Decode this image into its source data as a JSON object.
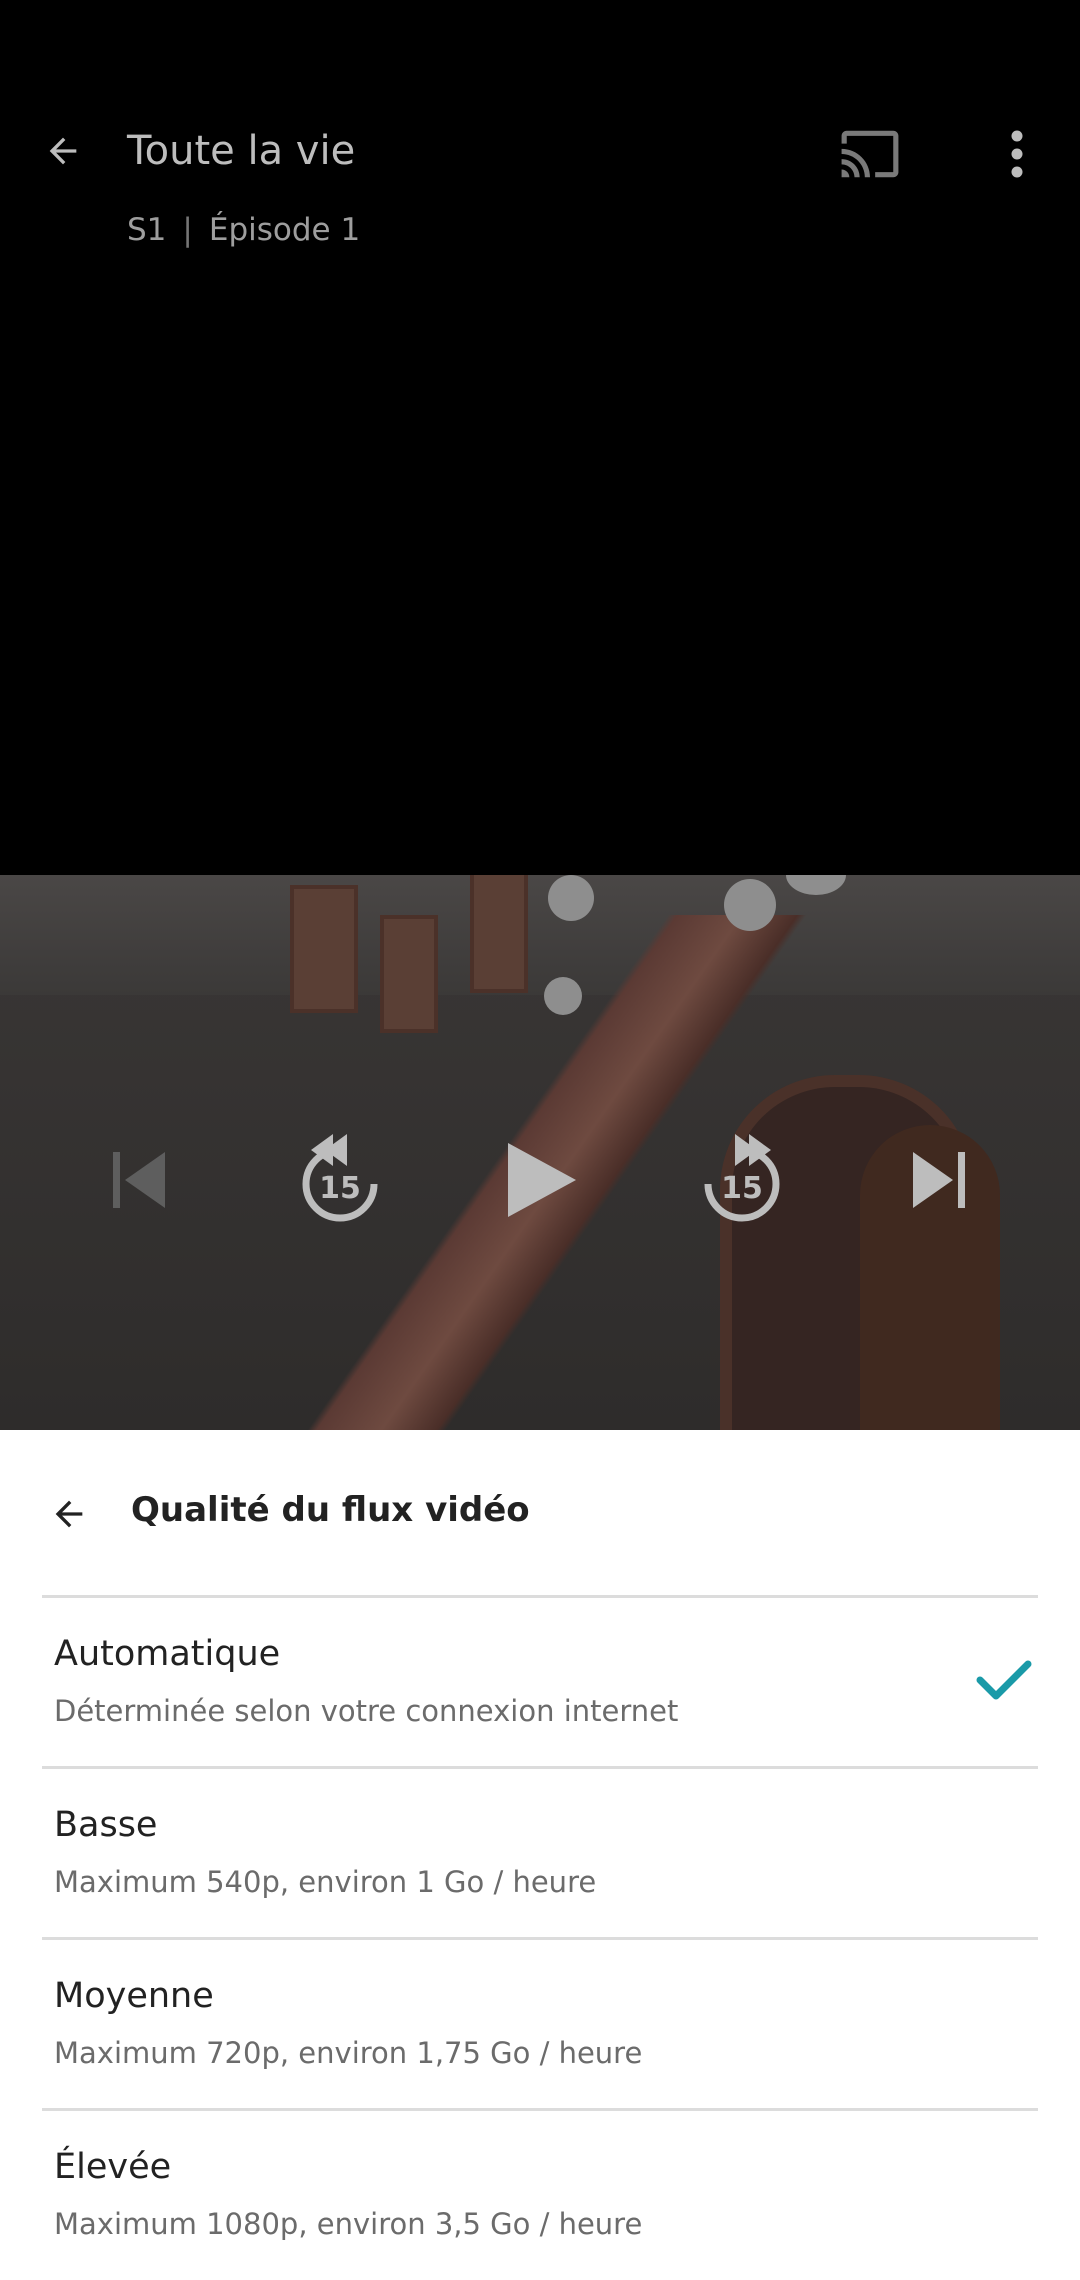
{
  "header": {
    "title": "Toute la vie",
    "season": "S1",
    "separator": "|",
    "episode": "Épisode 1",
    "icons": [
      "back-arrow-icon",
      "cast-icon",
      "more-vertical-icon"
    ]
  },
  "player": {
    "controls": [
      "skip-previous-icon",
      "rewind-15-icon",
      "play-icon",
      "forward-15-icon",
      "skip-next-icon"
    ],
    "rewind_seconds": "15",
    "forward_seconds": "15"
  },
  "quality_sheet": {
    "title": "Qualité du flux vidéo",
    "options": [
      {
        "label": "Automatique",
        "description": "Déterminée selon votre connexion internet",
        "selected": true
      },
      {
        "label": "Basse",
        "description": "Maximum 540p, environ 1 Go / heure",
        "selected": false
      },
      {
        "label": "Moyenne",
        "description": "Maximum 720p, environ 1,75 Go / heure",
        "selected": false
      },
      {
        "label": "Élevée",
        "description": "Maximum 1080p, environ 3,5 Go / heure",
        "selected": false
      }
    ]
  },
  "colors": {
    "accent_check": "#1a9aa8",
    "sheet_background": "#ffffff",
    "player_background": "#000000"
  }
}
